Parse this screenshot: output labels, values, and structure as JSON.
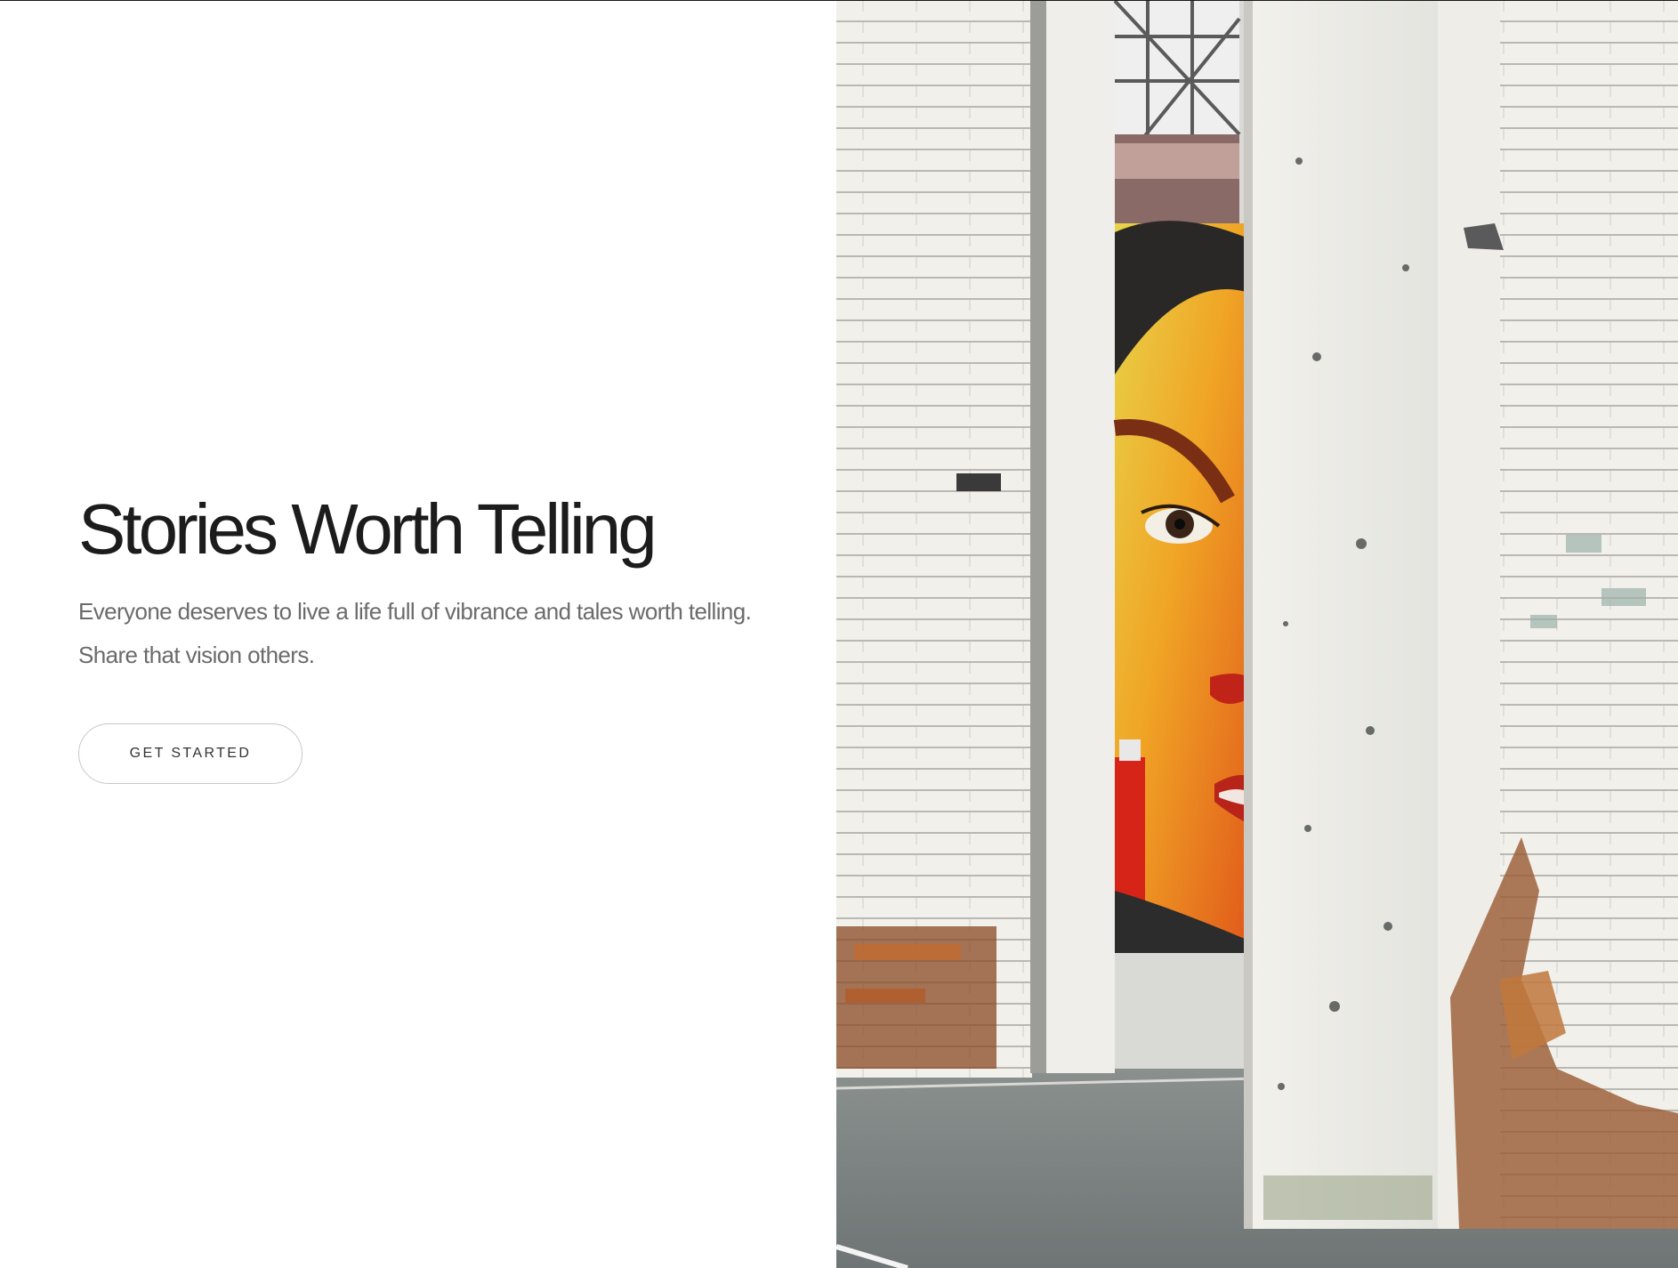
{
  "hero": {
    "title": "Stories Worth Telling",
    "subtitle": "Everyone deserves to live a life full of vibrance and tales worth telling. Share that vision others.",
    "cta_label": "GET STARTED"
  },
  "colors": {
    "background": "#ffffff",
    "title": "#1c1c1c",
    "subtitle": "#6b6b6b",
    "button_border": "#c8c8c8",
    "top_rule": "#1a1a1a"
  },
  "image": {
    "subject": "street-art-mural-between-white-brick-pillars"
  }
}
